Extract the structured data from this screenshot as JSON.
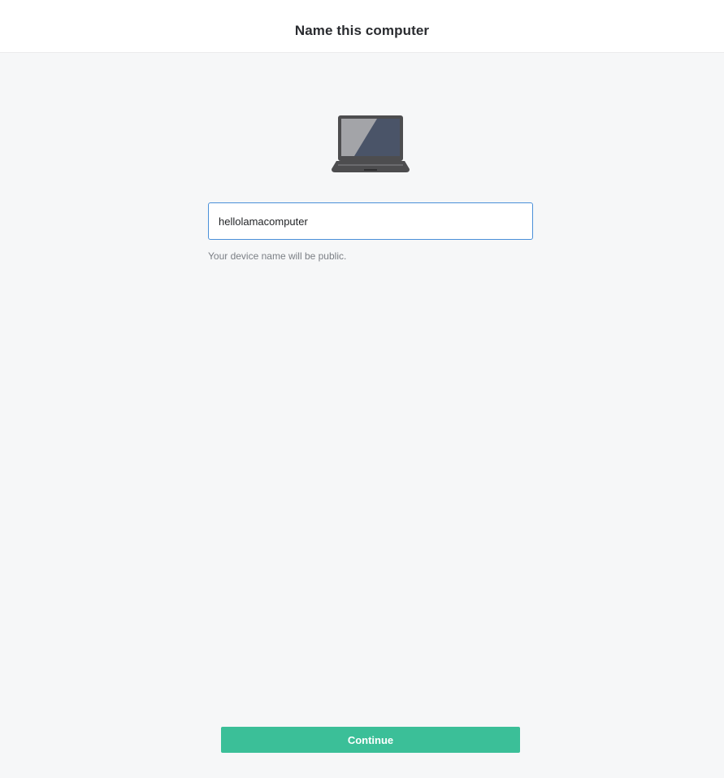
{
  "header": {
    "title": "Name this computer"
  },
  "device": {
    "icon": "laptop-icon",
    "name_value": "hellolamacomputer",
    "hint": "Your device name will be public."
  },
  "actions": {
    "continue_label": "Continue"
  },
  "colors": {
    "accent": "#3bbf98",
    "input_focus_border": "#4a90d9",
    "background": "#f6f7f8"
  }
}
